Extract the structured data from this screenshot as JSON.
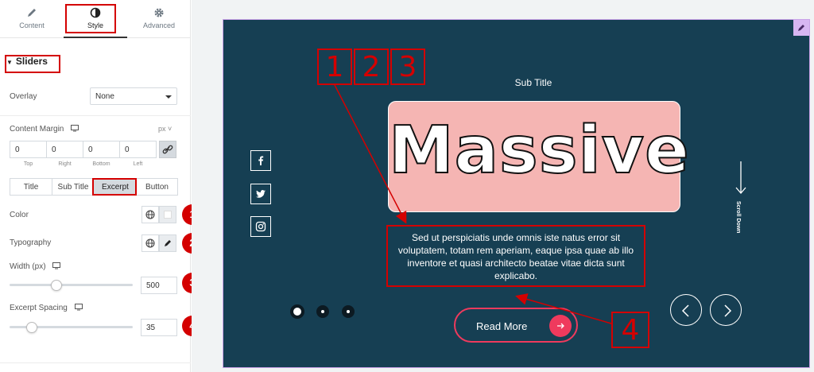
{
  "tabs": [
    {
      "label": "Content",
      "icon": "pencil-icon"
    },
    {
      "label": "Style",
      "icon": "half-circle-icon"
    },
    {
      "label": "Advanced",
      "icon": "gear-icon"
    }
  ],
  "section": {
    "title": "Sliders"
  },
  "overlay": {
    "label": "Overlay",
    "value": "None"
  },
  "content_margin": {
    "label": "Content Margin",
    "unit": "px",
    "values": [
      "0",
      "0",
      "0",
      "0"
    ],
    "captions": [
      "Top",
      "Right",
      "Bottom",
      "Left"
    ]
  },
  "segment": {
    "options": [
      "Title",
      "Sub Title",
      "Excerpt",
      "Button"
    ],
    "active": "Excerpt"
  },
  "controls": {
    "color_label": "Color",
    "typography_label": "Typography",
    "width_label": "Width (px)",
    "width_value": "500",
    "width_fraction": 0.38,
    "spacing_label": "Excerpt Spacing",
    "spacing_value": "35",
    "spacing_fraction": 0.18
  },
  "badges": [
    "1",
    "2",
    "3",
    "4"
  ],
  "preview": {
    "subtitle": "Sub Title",
    "title": "Massive",
    "excerpt": "Sed ut perspiciatis unde omnis iste natus error sit voluptatem, totam rem aperiam, eaque ipsa quae ab illo inventore et quasi architecto beatae vitae dicta sunt explicabo.",
    "button": "Read More",
    "scroll": "Scroll Down",
    "background": "#163f53",
    "title_box_color": "#f5b5b3",
    "accent": "#ef3a5d",
    "social": [
      "facebook-icon",
      "twitter-icon",
      "instagram-icon"
    ]
  },
  "annotations": {
    "labels": [
      "1",
      "2",
      "3",
      "4"
    ],
    "color": "#d40000"
  }
}
